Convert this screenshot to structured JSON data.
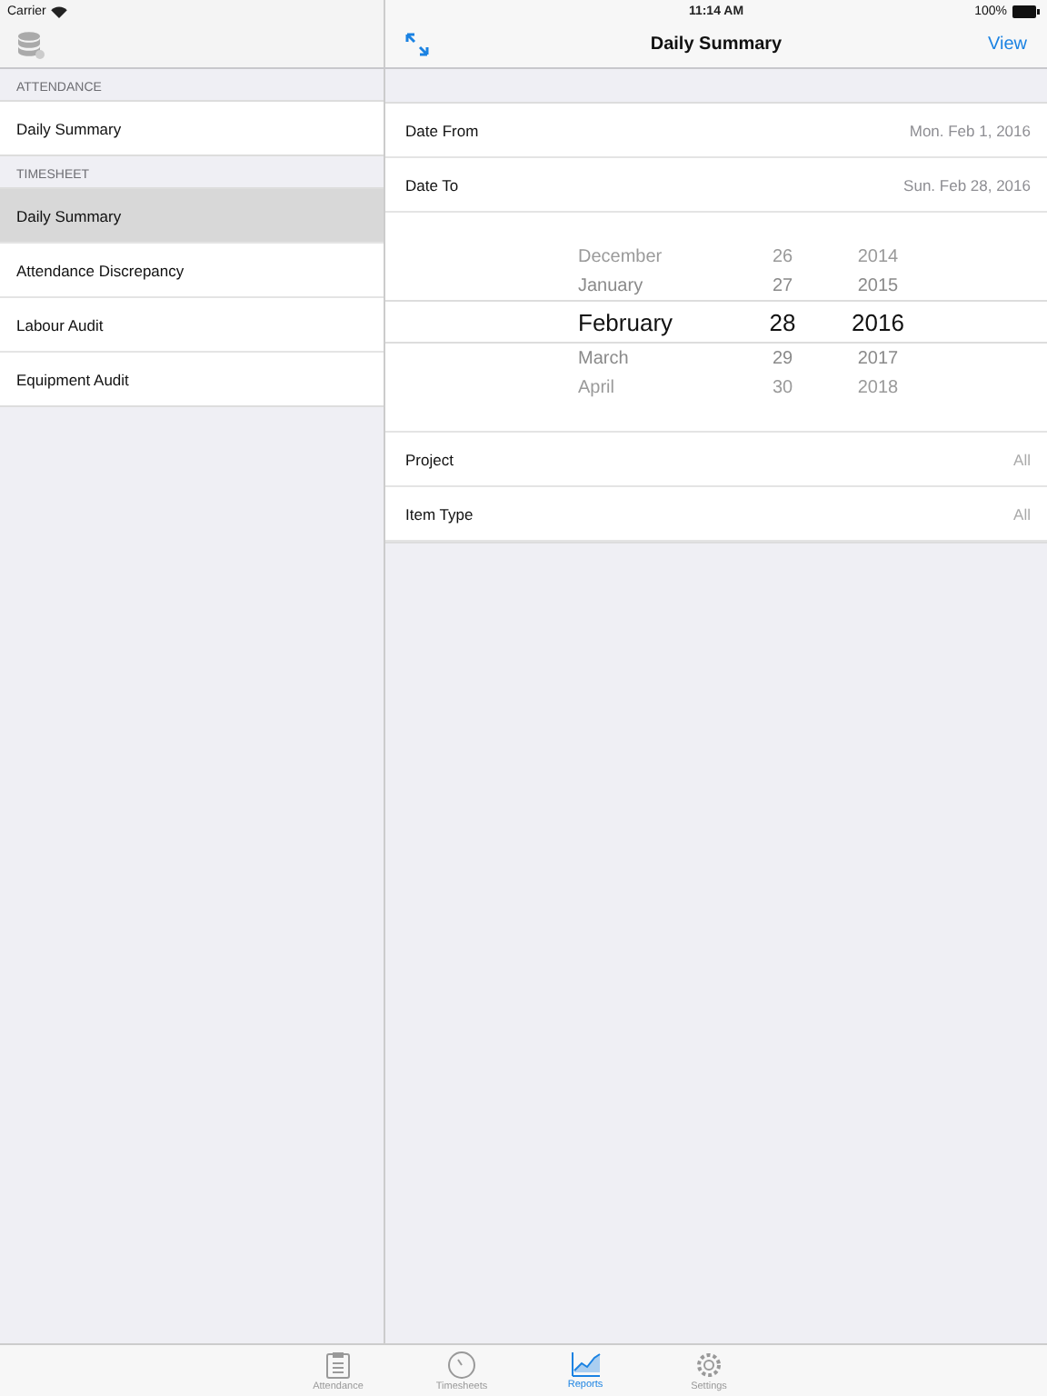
{
  "status_bar": {
    "carrier": "Carrier",
    "time": "11:14 AM",
    "battery": "100%"
  },
  "sidebar": {
    "sections": [
      {
        "header": "ATTENDANCE",
        "items": [
          {
            "label": "Daily Summary",
            "selected": false
          }
        ]
      },
      {
        "header": "TIMESHEET",
        "items": [
          {
            "label": "Daily Summary",
            "selected": true
          },
          {
            "label": "Attendance Discrepancy",
            "selected": false
          },
          {
            "label": "Labour Audit",
            "selected": false
          },
          {
            "label": "Equipment Audit",
            "selected": false
          }
        ]
      }
    ]
  },
  "nav": {
    "title": "Daily Summary",
    "action": "View"
  },
  "date_rows": [
    {
      "label": "Date From",
      "value": "Mon. Feb 1, 2016"
    },
    {
      "label": "Date To",
      "value": "Sun. Feb 28, 2016"
    }
  ],
  "picker": {
    "rows": [
      {
        "month": "December",
        "day": "26",
        "year": "2014",
        "selected": false
      },
      {
        "month": "January",
        "day": "27",
        "year": "2015",
        "selected": false
      },
      {
        "month": "February",
        "day": "28",
        "year": "2016",
        "selected": true
      },
      {
        "month": "March",
        "day": "29",
        "year": "2017",
        "selected": false
      },
      {
        "month": "April",
        "day": "30",
        "year": "2018",
        "selected": false
      }
    ]
  },
  "filter_rows": [
    {
      "label": "Project",
      "value": "All"
    },
    {
      "label": "Item Type",
      "value": "All"
    }
  ],
  "tab_bar": [
    {
      "label": "Attendance",
      "selected": false
    },
    {
      "label": "Timesheets",
      "selected": false
    },
    {
      "label": "Reports",
      "selected": true
    },
    {
      "label": "Settings",
      "selected": false
    }
  ]
}
